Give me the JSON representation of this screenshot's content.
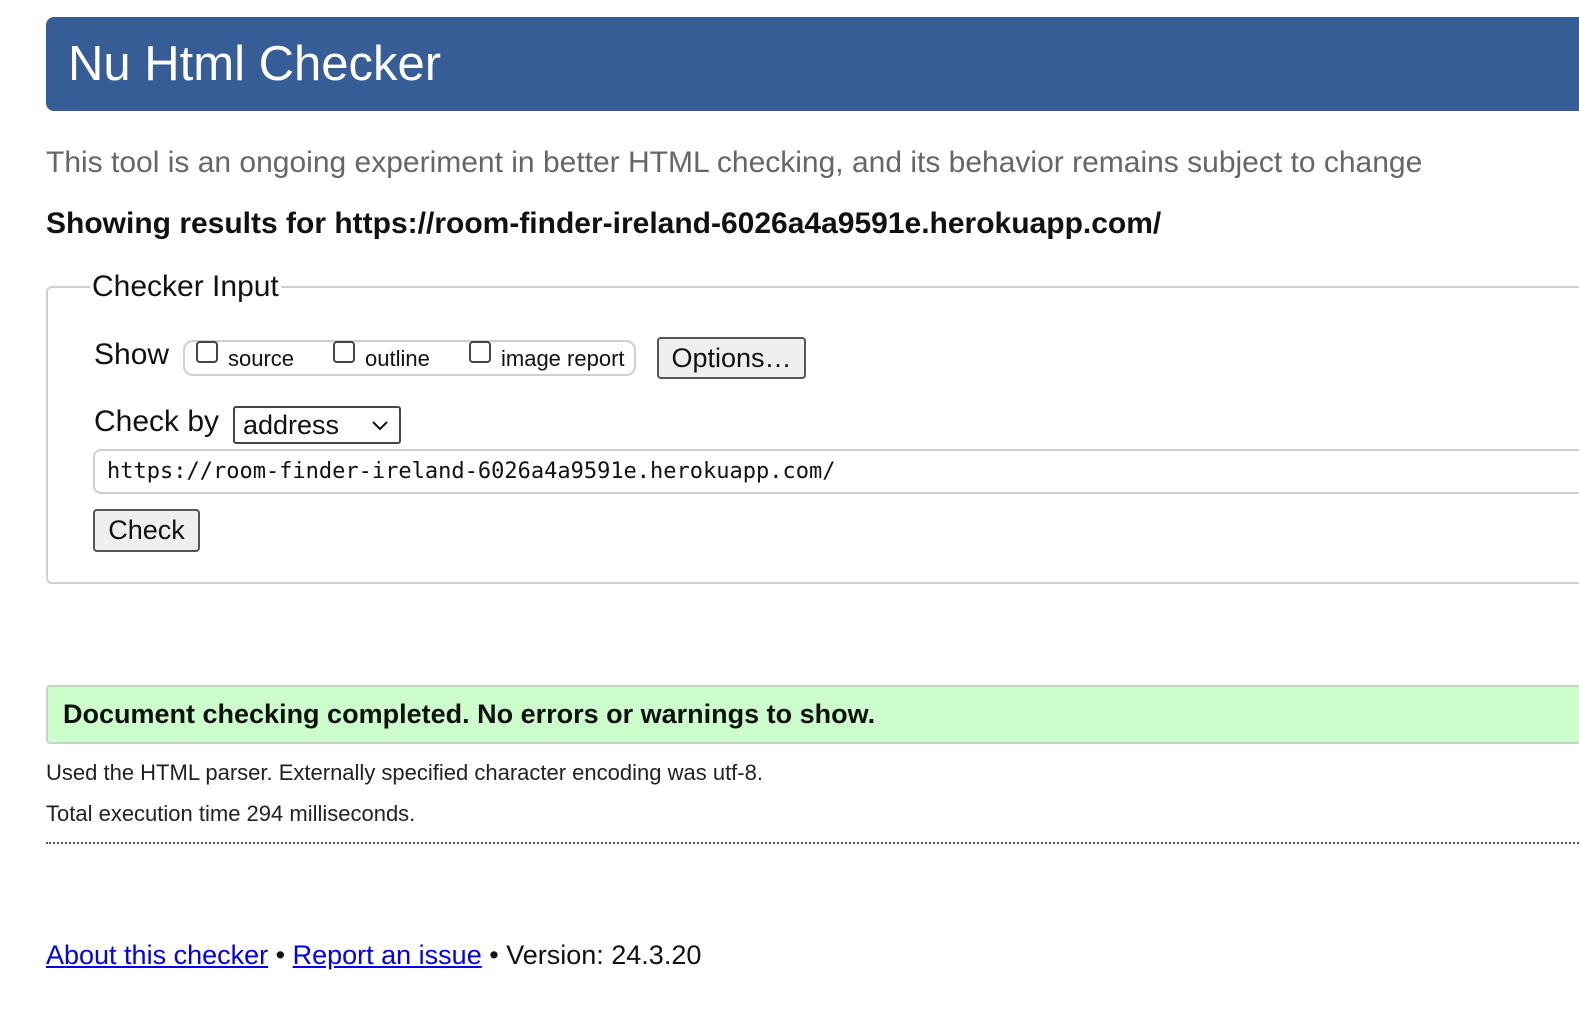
{
  "header": {
    "title": "Nu Html Checker"
  },
  "intro": "This tool is an ongoing experiment in better HTML checking, and its behavior remains subject to change",
  "results_heading": "Showing results for https://room-finder-ireland-6026a4a9591e.herokuapp.com/",
  "checker_input": {
    "legend": "Checker Input",
    "show_label": "Show",
    "checkboxes": [
      {
        "label": "source",
        "checked": false
      },
      {
        "label": "outline",
        "checked": false
      },
      {
        "label": "image report",
        "checked": false
      }
    ],
    "options_button": "Options…",
    "check_by_label": "Check by",
    "check_by_value": "address",
    "url_value": "https://room-finder-ireland-6026a4a9591e.herokuapp.com/",
    "check_button": "Check"
  },
  "result": {
    "success_message": "Document checking completed. No errors or warnings to show.",
    "parser_info": "Used the HTML parser. Externally specified character encoding was utf-8.",
    "execution_time": "Total execution time 294 milliseconds."
  },
  "footer": {
    "about_link": "About this checker",
    "separator": "•",
    "report_link": "Report an issue",
    "version": "Version: 24.3.20"
  },
  "colors": {
    "header_bg": "#365d95",
    "success_bg": "#ccffcc",
    "link": "#0000ee"
  }
}
